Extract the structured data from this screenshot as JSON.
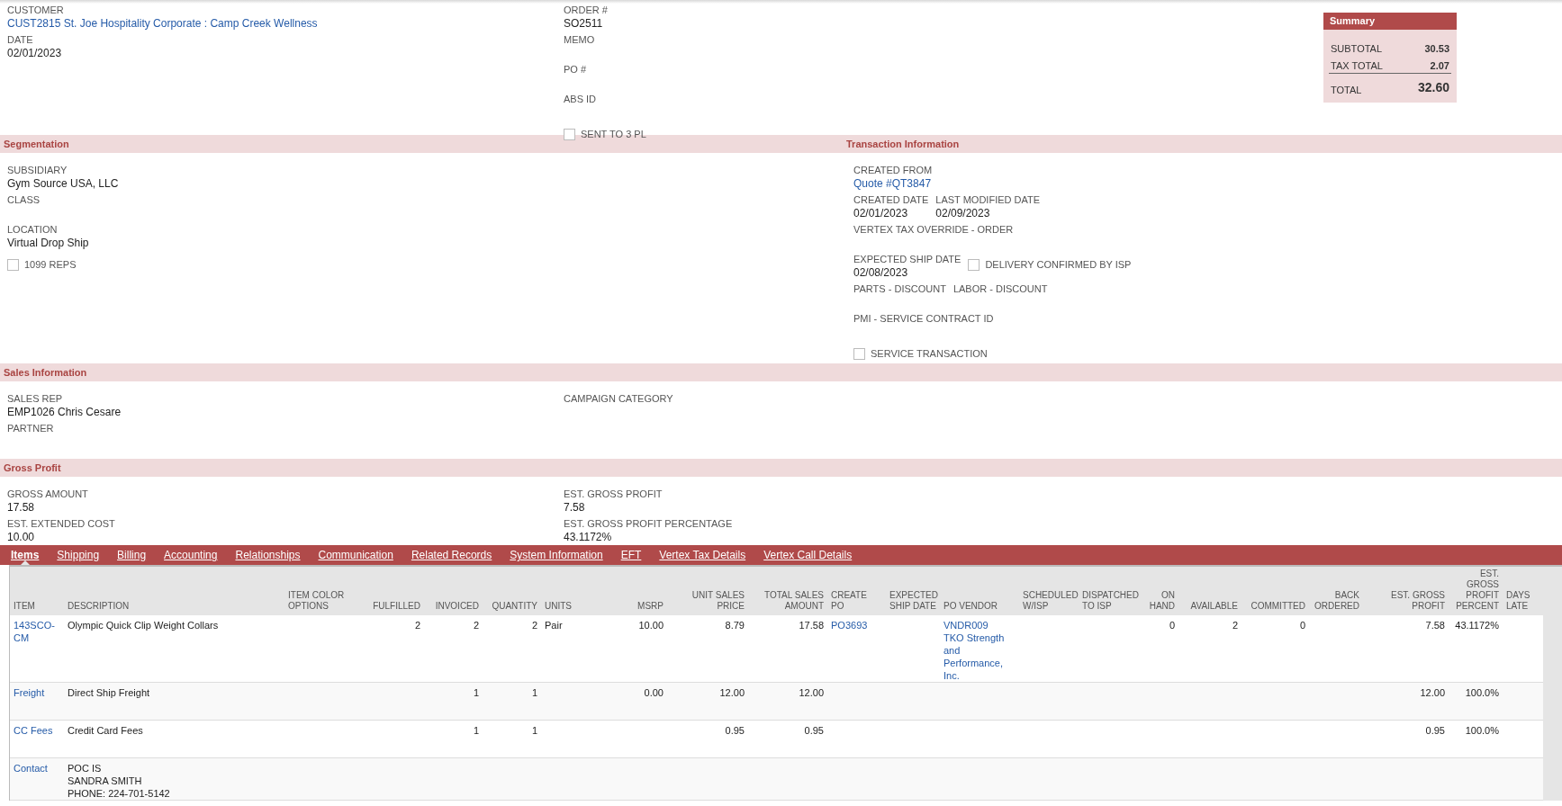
{
  "header": {
    "left": [
      {
        "kind": "link",
        "label": "CUSTOMER",
        "value": "CUST2815 St. Joe Hospitality Corporate : Camp Creek Wellness"
      },
      {
        "kind": "field",
        "label": "DATE",
        "value": "02/01/2023"
      }
    ],
    "middle": [
      {
        "kind": "field",
        "label": "ORDER #",
        "value": "SO2511"
      },
      {
        "kind": "field",
        "label": "MEMO"
      },
      {
        "kind": "field",
        "label": "PO #"
      },
      {
        "kind": "field",
        "label": "ABS ID"
      },
      {
        "kind": "checkbox",
        "label": "SENT TO 3 PL",
        "checked": false
      }
    ]
  },
  "summary": {
    "title": "Summary",
    "rows": [
      {
        "label": "SUBTOTAL",
        "value": "30.53"
      },
      {
        "label": "TAX TOTAL",
        "value": "2.07"
      }
    ],
    "total": {
      "label": "TOTAL",
      "value": "32.60"
    }
  },
  "sections": [
    {
      "kind": "panels",
      "panels": [
        {
          "title": "Segmentation",
          "fields": [
            {
              "kind": "field",
              "label": "SUBSIDIARY",
              "value": "Gym Source USA, LLC"
            },
            {
              "kind": "field",
              "label": "CLASS"
            },
            {
              "kind": "field",
              "label": "LOCATION",
              "value": "Virtual Drop Ship"
            },
            {
              "kind": "checkbox",
              "label": "1099 REPS",
              "checked": false
            }
          ]
        },
        {
          "title": "Transaction Information",
          "fields": [
            {
              "kind": "link",
              "label": "CREATED FROM",
              "value": "Quote #QT3847"
            },
            {
              "kind": "row",
              "items": [
                {
                  "kind": "field",
                  "label": "CREATED DATE",
                  "value": "02/01/2023"
                },
                {
                  "kind": "field",
                  "label": "LAST MODIFIED DATE",
                  "value": "02/09/2023"
                }
              ]
            },
            {
              "kind": "field",
              "label": "VERTEX TAX OVERRIDE - ORDER"
            },
            {
              "kind": "row",
              "items": [
                {
                  "kind": "field",
                  "label": "EXPECTED SHIP DATE",
                  "value": "02/08/2023"
                },
                {
                  "kind": "checkbox",
                  "label": "DELIVERY CONFIRMED BY ISP",
                  "checked": false
                }
              ]
            },
            {
              "kind": "row",
              "items": [
                {
                  "kind": "field",
                  "label": "PARTS - DISCOUNT"
                },
                {
                  "kind": "field",
                  "label": "LABOR - DISCOUNT"
                }
              ]
            },
            {
              "kind": "field",
              "label": "PMI - SERVICE CONTRACT ID"
            },
            {
              "kind": "checkbox",
              "label": "SERVICE TRANSACTION",
              "checked": false
            }
          ]
        }
      ]
    },
    {
      "kind": "columns",
      "title": "Sales Information",
      "columns": [
        [
          {
            "kind": "field",
            "label": "SALES REP",
            "value": "EMP1026 Chris Cesare"
          },
          {
            "kind": "field",
            "label": "PARTNER"
          }
        ],
        [
          {
            "kind": "field",
            "label": "CAMPAIGN CATEGORY"
          }
        ]
      ]
    },
    {
      "kind": "columns",
      "title": "Gross Profit",
      "columns": [
        [
          {
            "kind": "field",
            "label": "GROSS AMOUNT",
            "value": "17.58"
          },
          {
            "kind": "field",
            "label": "EST. EXTENDED COST",
            "value": "10.00"
          }
        ],
        [
          {
            "kind": "field",
            "label": "EST. GROSS PROFIT",
            "value": "7.58"
          },
          {
            "kind": "field",
            "label": "EST. GROSS PROFIT PERCENTAGE",
            "value": "43.1172%"
          }
        ]
      ]
    }
  ],
  "tabs": [
    {
      "label": "Items",
      "selected": true
    },
    {
      "label": "Shipping",
      "selected": false
    },
    {
      "label": "Billing",
      "selected": false
    },
    {
      "label": "Accounting",
      "selected": false
    },
    {
      "label": "Relationships",
      "selected": false
    },
    {
      "label": "Communication",
      "selected": false
    },
    {
      "label": "Related Records",
      "selected": false
    },
    {
      "label": "System Information",
      "selected": false
    },
    {
      "label": "EFT",
      "selected": false
    },
    {
      "label": "Vertex Tax Details",
      "selected": false
    },
    {
      "label": "Vertex Call Details",
      "selected": false
    }
  ],
  "table": {
    "columns": [
      {
        "label": "ITEM",
        "kind": "link"
      },
      {
        "label": "DESCRIPTION",
        "kind": "text"
      },
      {
        "label": "ITEM COLOR OPTIONS",
        "kind": "text"
      },
      {
        "label": "FULFILLED",
        "kind": "number"
      },
      {
        "label": "INVOICED",
        "kind": "number"
      },
      {
        "label": "QUANTITY",
        "kind": "number"
      },
      {
        "label": "UNITS",
        "kind": "text"
      },
      {
        "label": "MSRP",
        "kind": "number"
      },
      {
        "label": "UNIT SALES PRICE",
        "kind": "number"
      },
      {
        "label": "TOTAL SALES AMOUNT",
        "kind": "number"
      },
      {
        "label": "CREATE PO",
        "kind": "link"
      },
      {
        "label": "EXPECTED SHIP DATE",
        "kind": "text"
      },
      {
        "label": "PO VENDOR",
        "kind": "link"
      },
      {
        "label": "SCHEDULED W/ISP",
        "kind": "text"
      },
      {
        "label": "DISPATCHED TO ISP",
        "kind": "text"
      },
      {
        "label": "ON HAND",
        "kind": "number"
      },
      {
        "label": "AVAILABLE",
        "kind": "number"
      },
      {
        "label": "COMMITTED",
        "kind": "number"
      },
      {
        "label": "BACK ORDERED",
        "kind": "number"
      },
      {
        "label": "EST. GROSS PROFIT",
        "kind": "number"
      },
      {
        "label": "EST. GROSS PROFIT PERCENT",
        "kind": "number"
      },
      {
        "label": "DAYS LATE",
        "kind": "text"
      }
    ],
    "rows": [
      {
        "cells": [
          "143SCO-CM",
          "Olympic Quick Clip Weight Collars",
          null,
          "2",
          "2",
          "2",
          "Pair",
          "10.00",
          "8.79",
          "17.58",
          "PO3693",
          null,
          [
            "VNDR009",
            "TKO Strength and Performance, Inc."
          ],
          null,
          null,
          "0",
          "2",
          "0",
          null,
          "7.58",
          "43.1172%",
          null
        ]
      },
      {
        "cells": [
          "Freight",
          "Direct Ship Freight",
          null,
          null,
          "1",
          "1",
          null,
          "0.00",
          "12.00",
          "12.00",
          null,
          null,
          null,
          null,
          null,
          null,
          null,
          null,
          null,
          "12.00",
          "100.0%",
          null
        ]
      },
      {
        "cells": [
          "CC Fees",
          "Credit Card Fees",
          null,
          null,
          "1",
          "1",
          null,
          null,
          "0.95",
          "0.95",
          null,
          null,
          null,
          null,
          null,
          null,
          null,
          null,
          null,
          "0.95",
          "100.0%",
          null
        ]
      },
      {
        "cells": [
          "Contact",
          [
            "POC IS",
            "SANDRA SMITH",
            "PHONE: 224-701-5142"
          ]
        ]
      }
    ]
  }
}
